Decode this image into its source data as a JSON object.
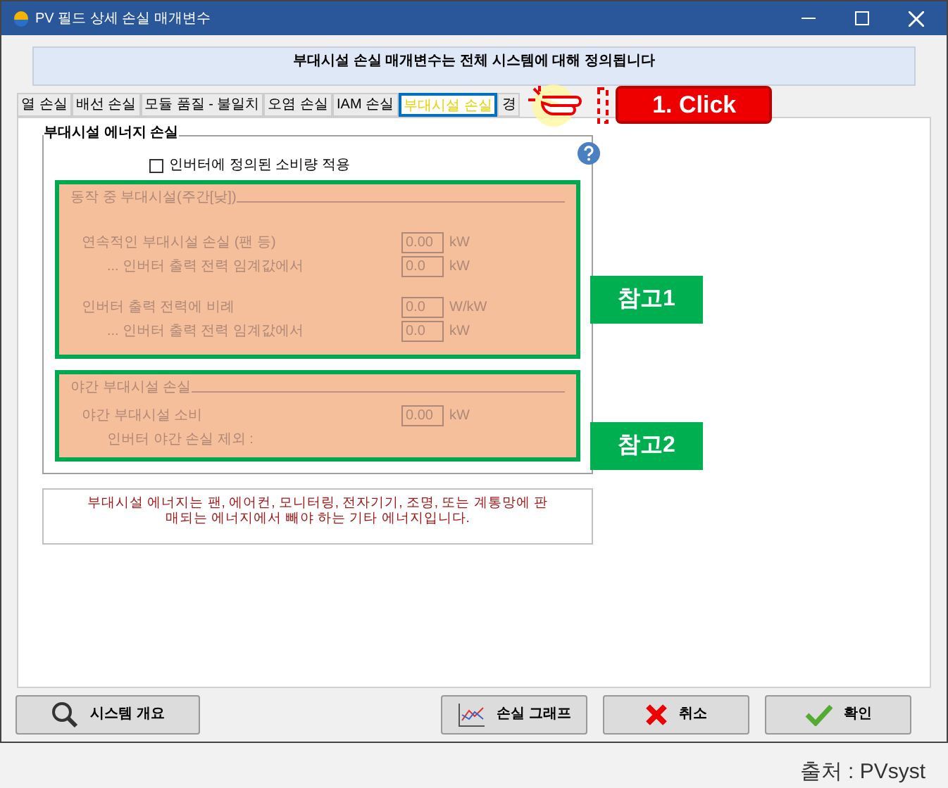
{
  "window": {
    "title": "PV 필드 상세 손실 매개변수"
  },
  "banner": "부대시설 손실 매개변수는 전체 시스템에 대해 정의됩니다",
  "tabs": [
    {
      "label": "열 손실",
      "selected": false
    },
    {
      "label": "배선 손실",
      "selected": false
    },
    {
      "label": "모듈 품질 - 불일치",
      "selected": false
    },
    {
      "label": "오염 손실",
      "selected": false
    },
    {
      "label": "IAM 손실",
      "selected": false
    },
    {
      "label": "부대시설 손실",
      "selected": true
    },
    {
      "label": "경",
      "selected": false
    }
  ],
  "click_callout": "1. Click",
  "group": {
    "title": "부대시설 에너지 손실",
    "checkbox": {
      "label": "인버터에 정의된 소비량 적용",
      "checked": false
    },
    "sections": [
      {
        "title": "동작 중 부대시설(주간[낮])",
        "callout": "참고1",
        "rows": [
          {
            "label": "연속적인 부대시설 손실 (팬 등)",
            "value": "0.00",
            "unit": "kW",
            "indent": false,
            "disabled": true
          },
          {
            "label": "... 인버터 출력 전력 임계값에서",
            "value": "0.0",
            "unit": "kW",
            "indent": true,
            "disabled": true
          },
          {
            "label": "인버터 출력 전력에 비례",
            "value": "0.0",
            "unit": "W/kW",
            "indent": false,
            "disabled": true
          },
          {
            "label": "... 인버터 출력 전력 임계값에서",
            "value": "0.0",
            "unit": "kW",
            "indent": true,
            "disabled": true
          }
        ]
      },
      {
        "title": "야간 부대시설 손실",
        "callout": "참고2",
        "rows": [
          {
            "label": "야간 부대시설 소비",
            "value": "0.00",
            "unit": "kW",
            "indent": false,
            "disabled": true
          },
          {
            "label": "인버터 야간 손실 제외 :",
            "indent": true,
            "disabled": true
          }
        ]
      }
    ]
  },
  "note": "부대시설 에너지는 팬, 에어컨, 모니터링, 전자기기, 조명, 또는 계통망에 판매되는 에너지에서 빼야 하는 기타 에너지입니다.",
  "buttons": [
    {
      "kind": "overview",
      "label": "시스템 개요"
    },
    {
      "kind": "graph",
      "label": "손실 그래프"
    },
    {
      "kind": "cancel",
      "label": "취소"
    },
    {
      "kind": "ok",
      "label": "확인"
    }
  ],
  "source": "출처 : PVsyst"
}
